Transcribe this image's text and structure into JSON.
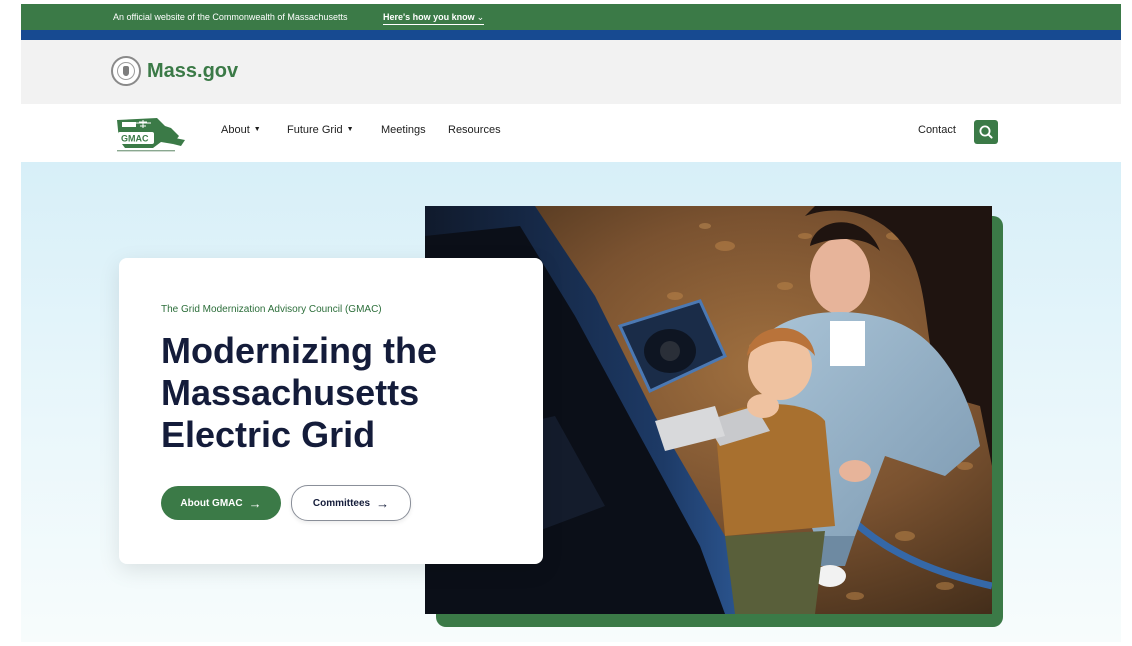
{
  "official_banner": {
    "text": "An official website of the Commonwealth of Massachusetts",
    "how_label": "Here's how you know",
    "how_caret": "⌄"
  },
  "massgov": {
    "logo_text": "Mass.gov",
    "seal_icon": "state-seal-icon"
  },
  "nav": {
    "logo_text": "GMAC",
    "items": [
      {
        "label": "About",
        "caret": "▼"
      },
      {
        "label": "Future Grid",
        "caret": "▼"
      },
      {
        "label": "Meetings"
      },
      {
        "label": "Resources"
      }
    ],
    "contact_label": "Contact",
    "search_icon": "search-icon"
  },
  "hero": {
    "eyebrow": "The Grid Modernization Advisory Council (GMAC)",
    "title": "Modernizing the Massachusetts Electric Grid",
    "buttons": [
      {
        "label": "About GMAC",
        "arrow": "→"
      },
      {
        "label": "Committees",
        "arrow": "→"
      }
    ]
  },
  "colors": {
    "brand_green": "#3b7a47",
    "stripe_blue": "#174a91",
    "title_navy": "#141c3a"
  }
}
